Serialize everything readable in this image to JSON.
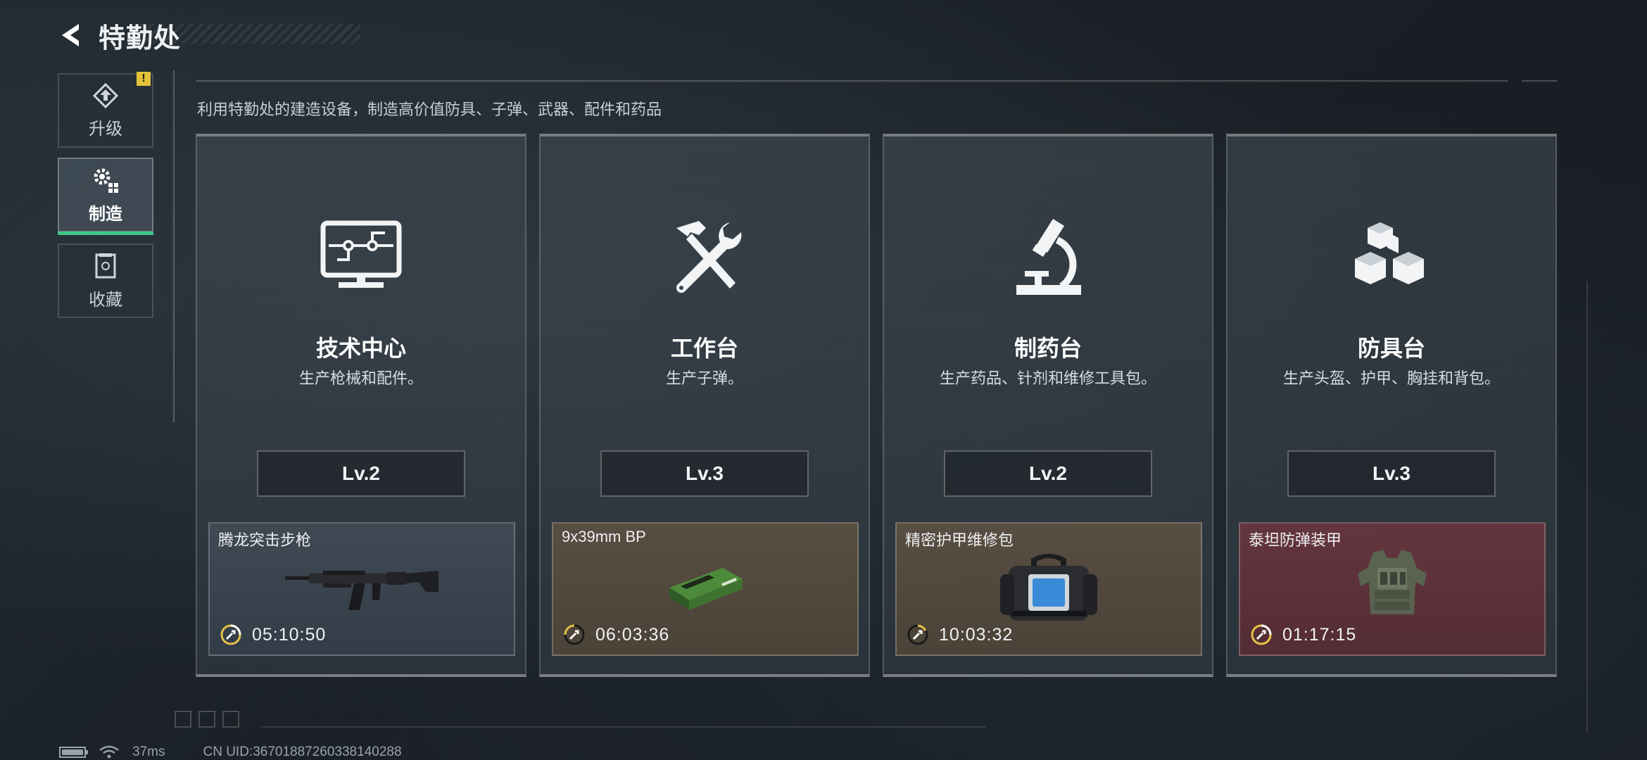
{
  "header": {
    "title": "特勤处"
  },
  "sidebar": {
    "items": [
      {
        "label": "升级",
        "icon": "upgrade-icon",
        "badge": "!"
      },
      {
        "label": "制造",
        "icon": "gears-icon",
        "active": true
      },
      {
        "label": "收藏",
        "icon": "collection-icon"
      }
    ]
  },
  "description": "利用特勤处的建造设备，制造高价值防具、子弹、武器、配件和药品",
  "stations": [
    {
      "name": "技术中心",
      "desc": "生产枪械和配件。",
      "icon": "monitor-circuit-icon",
      "level": "Lv.2",
      "crafting": {
        "item": "腾龙突击步枪",
        "item_icon": "assault-rifle-icon",
        "timer": "05:10:50",
        "color": "#48566a"
      }
    },
    {
      "name": "工作台",
      "desc": "生产子弹。",
      "icon": "hammer-wrench-icon",
      "level": "Lv.3",
      "crafting": {
        "item": "9x39mm BP",
        "item_icon": "ammo-box-icon",
        "timer": "06:03:36",
        "color": "#5c5042"
      }
    },
    {
      "name": "制药台",
      "desc": "生产药品、针剂和维修工具包。",
      "icon": "microscope-icon",
      "level": "Lv.2",
      "crafting": {
        "item": "精密护甲维修包",
        "item_icon": "repair-bag-icon",
        "timer": "10:03:32",
        "color": "#5c5042"
      }
    },
    {
      "name": "防具台",
      "desc": "生产头盔、护甲、胸挂和背包。",
      "icon": "cubes-icon",
      "level": "Lv.3",
      "crafting": {
        "item": "泰坦防弹装甲",
        "item_icon": "body-armor-icon",
        "timer": "01:17:15",
        "color": "#68363e"
      }
    }
  ],
  "status_bar": {
    "ping": "37ms",
    "uid": "CN UID:36701887260338140288"
  }
}
